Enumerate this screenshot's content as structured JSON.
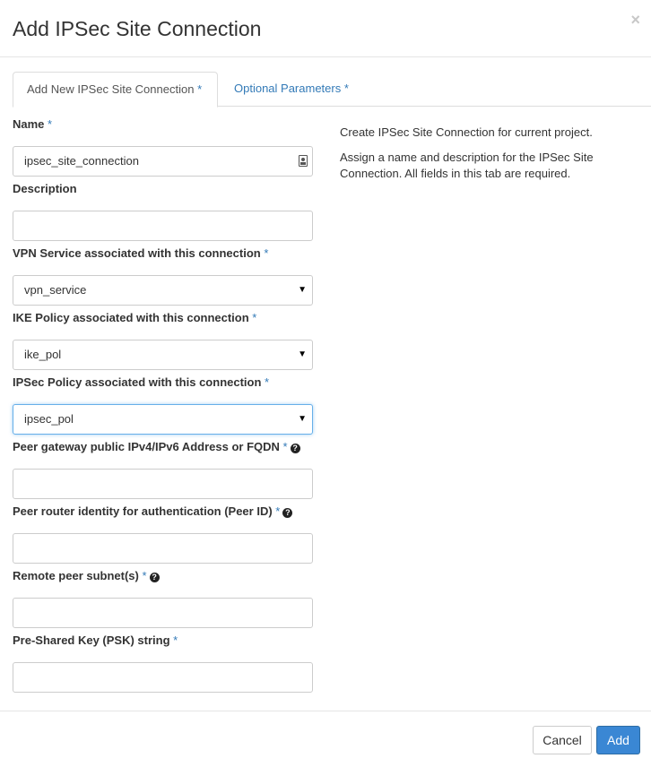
{
  "modal": {
    "title": "Add IPSec Site Connection",
    "close_glyph": "×"
  },
  "tabs": [
    {
      "label": "Add New IPSec Site Connection",
      "required_mark": "*",
      "active": true
    },
    {
      "label": "Optional Parameters",
      "required_mark": "*",
      "active": false
    }
  ],
  "fields": {
    "name": {
      "label": "Name",
      "required_mark": "*",
      "value": "ipsec_site_connection"
    },
    "description": {
      "label": "Description",
      "value": ""
    },
    "vpn_service": {
      "label": "VPN Service associated with this connection",
      "required_mark": "*",
      "selected": "vpn_service"
    },
    "ike_policy": {
      "label": "IKE Policy associated with this connection",
      "required_mark": "*",
      "selected": "ike_pol"
    },
    "ipsec_policy": {
      "label": "IPSec Policy associated with this connection",
      "required_mark": "*",
      "selected": "ipsec_pol"
    },
    "peer_address": {
      "label": "Peer gateway public IPv4/IPv6 Address or FQDN",
      "required_mark": "*",
      "value": ""
    },
    "peer_id": {
      "label": "Peer router identity for authentication (Peer ID)",
      "required_mark": "*",
      "value": ""
    },
    "peer_cidrs": {
      "label": "Remote peer subnet(s)",
      "required_mark": "*",
      "value": ""
    },
    "psk": {
      "label": "Pre-Shared Key (PSK) string",
      "required_mark": "*",
      "value": ""
    }
  },
  "help": {
    "line1": "Create IPSec Site Connection for current project.",
    "line2": "Assign a name and description for the IPSec Site Connection. All fields in this tab are required."
  },
  "footer": {
    "cancel_label": "Cancel",
    "add_label": "Add"
  },
  "colors": {
    "link": "#337ab7",
    "primary": "#3a87d4",
    "focus": "#66afe9"
  },
  "icons": {
    "help": "question-circle-icon",
    "dropdown": "caret-down-icon",
    "autofill": "contact-card-icon"
  }
}
